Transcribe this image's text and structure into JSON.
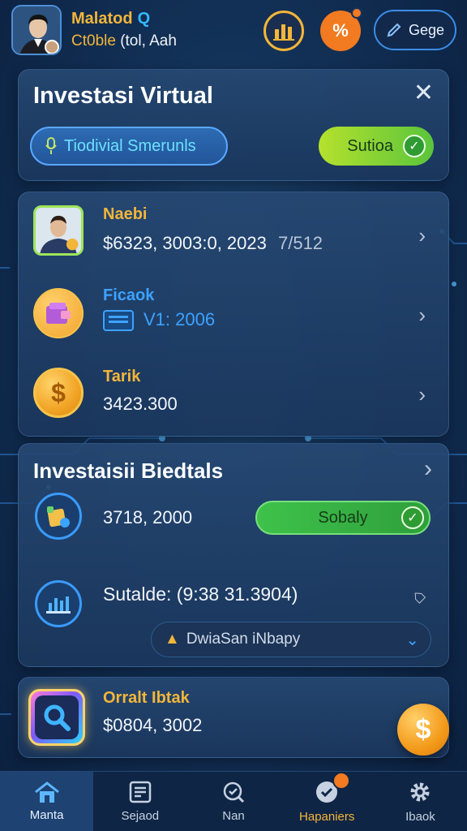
{
  "header": {
    "user_name": "Malatod",
    "user_sub_prefix": "Ct0ble",
    "user_sub_suffix": "(tol, Aah",
    "edit_label": "Gege"
  },
  "card_virtual": {
    "title": "Investasi Virtual",
    "field_label": "Tiodivial Smerunls",
    "status_label": "Sutioa"
  },
  "rows": [
    {
      "title": "Naebi",
      "value": "$6323, 3003:0, 2023",
      "extra": "7/512"
    },
    {
      "title": "Ficaok",
      "value": "V1: 2006"
    },
    {
      "title": "Tarik",
      "value": "3423.300"
    }
  ],
  "card_bidtals": {
    "title": "Investaisii Biedtals",
    "amount": "3718, 2000",
    "status_label": "Sobaly",
    "sutalde_text": "Sutalde: (9:38 31.3904)",
    "dropdown_label": "DwiaSan iNbapy"
  },
  "card_orralt": {
    "title": "Orralt Ibtak",
    "value": "$0804, 3002"
  },
  "nav": [
    {
      "label": "Manta"
    },
    {
      "label": "Sejaod"
    },
    {
      "label": "Nan"
    },
    {
      "label": "Hapaniers"
    },
    {
      "label": "Ibaok"
    }
  ],
  "colors": {
    "accent_gold": "#f3b63a",
    "accent_blue": "#3da2ff",
    "success_green": "#3ec24b",
    "orange": "#f27a20",
    "background": "#123056"
  }
}
